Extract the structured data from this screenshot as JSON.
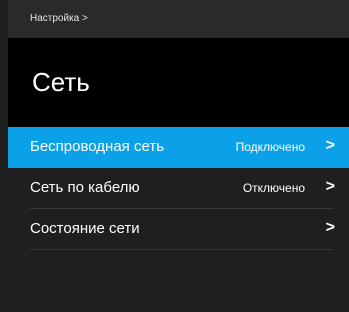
{
  "breadcrumb": "Настройка >",
  "title": "Сеть",
  "items": [
    {
      "label": "Беспроводная сеть",
      "status": "Подключено",
      "chevron": ">",
      "selected": true
    },
    {
      "label": "Сеть по кабелю",
      "status": "Отключено",
      "chevron": ">",
      "selected": false
    },
    {
      "label": "Состояние сети",
      "status": "",
      "chevron": ">",
      "selected": false
    }
  ],
  "colors": {
    "selected_row": "#0ba1e8",
    "header_background": "#000000",
    "top_bar_background": "#2a2a2a",
    "screen_background": "#1f1f1f"
  },
  "icons": {
    "chevron": "chevron-right-icon"
  }
}
